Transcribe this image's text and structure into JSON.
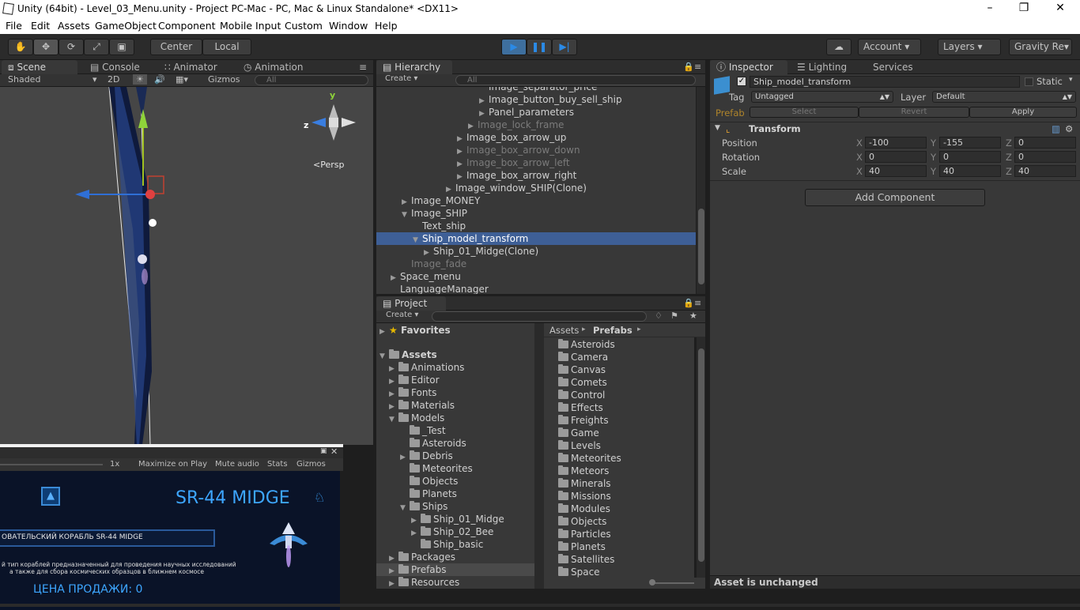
{
  "window": {
    "title": "Unity (64bit) - Level_03_Menu.unity - Project PC-Mac - PC, Mac & Linux Standalone* <DX11>"
  },
  "menu": [
    "File",
    "Edit",
    "Assets",
    "GameObject",
    "Component",
    "Mobile Input",
    "Custom",
    "Window",
    "Help"
  ],
  "toolbar": {
    "center": "Center",
    "local": "Local",
    "account": "Account",
    "layers": "Layers",
    "layout": "Gravity Re"
  },
  "scene": {
    "tabs": {
      "scene": "Scene",
      "console": "Console",
      "animator": "Animator",
      "animation": "Animation"
    },
    "shading": "Shaded",
    "mode2d": "2D",
    "gizmos": "Gizmos",
    "search": "All",
    "persp": "Persp",
    "axis_y": "y",
    "axis_z": "z"
  },
  "game": {
    "zoom": "1x",
    "maximize": "Maximize on Play",
    "mute": "Mute audio",
    "stats": "Stats",
    "gizmos": "Gizmos",
    "ship_title": "SR-44 MIDGE",
    "ship_label": "ОВАТЕЛЬСКИЙ КОРАБЛЬ SR-44 MIDGE",
    "desc1": "й тип кораблей предназначенный для проведения научных исследований",
    "desc2": "а также для сбора космических образцов в ближнем космосе",
    "price": "ЦЕНА ПРОДАЖИ: 0"
  },
  "hierarchy": {
    "tab": "Hierarchy",
    "create": "Create",
    "search": "All",
    "rows": [
      {
        "text": "Image_separator_price",
        "indent": 130,
        "arrow": "",
        "dim": false
      },
      {
        "text": "Image_button_buy_sell_ship",
        "indent": 130,
        "arrow": "▶",
        "dim": false
      },
      {
        "text": "Panel_parameters",
        "indent": 130,
        "arrow": "▶",
        "dim": false
      },
      {
        "text": "Image_lock_frame",
        "indent": 116,
        "arrow": "▶",
        "dim": true
      },
      {
        "text": "Image_box_arrow_up",
        "indent": 102,
        "arrow": "▶",
        "dim": false
      },
      {
        "text": "Image_box_arrow_down",
        "indent": 102,
        "arrow": "▶",
        "dim": true
      },
      {
        "text": "Image_box_arrow_left",
        "indent": 102,
        "arrow": "▶",
        "dim": true
      },
      {
        "text": "Image_box_arrow_right",
        "indent": 102,
        "arrow": "▶",
        "dim": false
      },
      {
        "text": "Image_window_SHIP(Clone)",
        "indent": 88,
        "arrow": "▶",
        "dim": false
      },
      {
        "text": "Image_MONEY",
        "indent": 32,
        "arrow": "▶",
        "dim": false
      },
      {
        "text": "Image_SHIP",
        "indent": 32,
        "arrow": "▼",
        "dim": false
      },
      {
        "text": "Text_ship",
        "indent": 46,
        "arrow": "",
        "dim": false
      },
      {
        "text": "Ship_model_transform",
        "indent": 46,
        "arrow": "▼",
        "dim": false,
        "selected": true
      },
      {
        "text": "Ship_01_Midge(Clone)",
        "indent": 60,
        "arrow": "▶",
        "dim": false
      },
      {
        "text": "Image_fade",
        "indent": 32,
        "arrow": "",
        "dim": true
      },
      {
        "text": "Space_menu",
        "indent": 18,
        "arrow": "▶",
        "dim": false
      },
      {
        "text": "LanguageManager",
        "indent": 18,
        "arrow": "",
        "dim": false
      }
    ]
  },
  "project": {
    "tab": "Project",
    "create": "Create",
    "favorites": "Favorites",
    "assets": "Assets",
    "tree": [
      {
        "text": "Animations",
        "indent": 28,
        "arrow": "▶"
      },
      {
        "text": "Editor",
        "indent": 28,
        "arrow": "▶"
      },
      {
        "text": "Fonts",
        "indent": 28,
        "arrow": "▶"
      },
      {
        "text": "Materials",
        "indent": 28,
        "arrow": "▶"
      },
      {
        "text": "Models",
        "indent": 28,
        "arrow": "▼"
      },
      {
        "text": "_Test",
        "indent": 42,
        "arrow": ""
      },
      {
        "text": "Asteroids",
        "indent": 42,
        "arrow": ""
      },
      {
        "text": "Debris",
        "indent": 42,
        "arrow": "▶"
      },
      {
        "text": "Meteorites",
        "indent": 42,
        "arrow": ""
      },
      {
        "text": "Objects",
        "indent": 42,
        "arrow": ""
      },
      {
        "text": "Planets",
        "indent": 42,
        "arrow": ""
      },
      {
        "text": "Ships",
        "indent": 42,
        "arrow": "▼"
      },
      {
        "text": "Ship_01_Midge",
        "indent": 56,
        "arrow": "▶"
      },
      {
        "text": "Ship_02_Bee",
        "indent": 56,
        "arrow": "▶"
      },
      {
        "text": "Ship_basic",
        "indent": 56,
        "arrow": ""
      },
      {
        "text": "Packages",
        "indent": 28,
        "arrow": "▶"
      },
      {
        "text": "Prefabs",
        "indent": 28,
        "arrow": "▶",
        "selected": true
      },
      {
        "text": "Resources",
        "indent": 28,
        "arrow": "▶"
      }
    ],
    "breadcrumb": {
      "root": "Assets",
      "current": "Prefabs"
    },
    "folders": [
      "Asteroids",
      "Camera",
      "Canvas",
      "Comets",
      "Control",
      "Effects",
      "Freights",
      "Game",
      "Levels",
      "Meteorites",
      "Meteors",
      "Minerals",
      "Missions",
      "Modules",
      "Objects",
      "Particles",
      "Planets",
      "Satellites",
      "Space"
    ]
  },
  "inspector": {
    "tabs": {
      "inspector": "Inspector",
      "lighting": "Lighting",
      "services": "Services"
    },
    "object_name": "Ship_model_transform",
    "static": "Static",
    "tag_label": "Tag",
    "tag_value": "Untagged",
    "layer_label": "Layer",
    "layer_value": "Default",
    "prefab_label": "Prefab",
    "select": "Select",
    "revert": "Revert",
    "apply": "Apply",
    "transform": "Transform",
    "position": {
      "label": "Position",
      "x": "-100",
      "y": "-155",
      "z": "0"
    },
    "rotation": {
      "label": "Rotation",
      "x": "0",
      "y": "0",
      "z": "0"
    },
    "scale": {
      "label": "Scale",
      "x": "40",
      "y": "40",
      "z": "40"
    },
    "add_component": "Add Component",
    "status": "Asset is unchanged"
  }
}
